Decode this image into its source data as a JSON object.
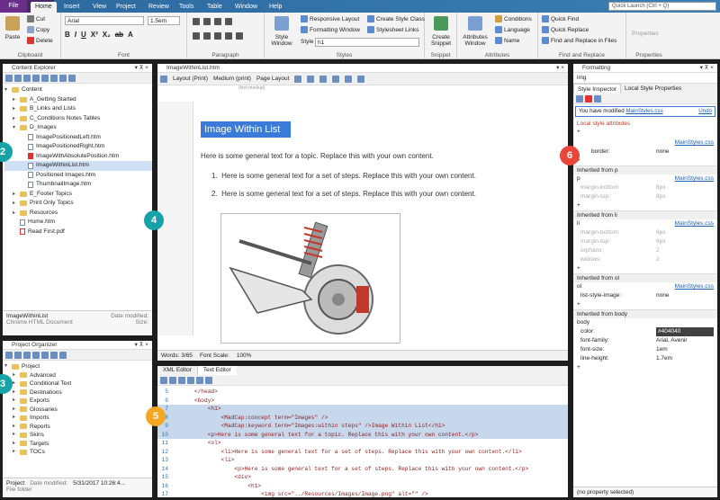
{
  "ribbon": {
    "file": "File",
    "tabs": [
      "Home",
      "Insert",
      "View",
      "Project",
      "Review",
      "Tools",
      "Table",
      "Window",
      "Help"
    ],
    "quick_launch": "Quick Launch (Ctrl + Q)",
    "clipboard": {
      "paste": "Paste",
      "cut": "Cut",
      "copy": "Copy",
      "delete": "Delete",
      "label": "Clipboard"
    },
    "font": {
      "family": "Arial",
      "size": "1.5em",
      "label": "Font"
    },
    "paragraph": {
      "label": "Paragraph"
    },
    "styles": {
      "style_window": "Style Window",
      "responsive": "Responsive Layout",
      "formatting": "Formatting Window",
      "create_class": "Create Style Class",
      "stylesheet_links": "Stylesheet Links",
      "style_label": "Style",
      "style_value": "h1",
      "label": "Styles"
    },
    "snippet": {
      "create": "Create Snippet",
      "label": "Snippet"
    },
    "attributes": {
      "window": "Attributes Window",
      "conditions": "Conditions",
      "language": "Language",
      "name": "Name",
      "label": "Attributes"
    },
    "find": {
      "quick_find": "Quick Find",
      "quick_replace": "Quick Replace",
      "find_replace": "Find and Replace in Files",
      "label": "Find and Replace"
    },
    "properties": {
      "props1": "Properties",
      "props2": "Properties"
    }
  },
  "content_explorer": {
    "title": "Content Explorer",
    "items": [
      {
        "t": "Content",
        "d": 0,
        "k": "folder"
      },
      {
        "t": "A_Getting Started",
        "d": 1,
        "k": "folder"
      },
      {
        "t": "B_Links and Lists",
        "d": 1,
        "k": "folder"
      },
      {
        "t": "C_Conditions Notes Tables",
        "d": 1,
        "k": "folder"
      },
      {
        "t": "D_Images",
        "d": 1,
        "k": "folder"
      },
      {
        "t": "ImagePositionedLeft.htm",
        "d": 2,
        "k": "file"
      },
      {
        "t": "ImagePositionedRight.htm",
        "d": 2,
        "k": "file"
      },
      {
        "t": "ImageWithAbsolutePosition.htm",
        "d": 2,
        "k": "file"
      },
      {
        "t": "ImageWithinList.htm",
        "d": 2,
        "k": "file"
      },
      {
        "t": "Positioned Images.htm",
        "d": 2,
        "k": "file"
      },
      {
        "t": "ThumbnailImage.htm",
        "d": 2,
        "k": "file"
      },
      {
        "t": "E_Footer Topics",
        "d": 1,
        "k": "folder"
      },
      {
        "t": "Print Only Topics",
        "d": 1,
        "k": "folder"
      },
      {
        "t": "Resources",
        "d": 1,
        "k": "folder"
      },
      {
        "t": "Home.htm",
        "d": 1,
        "k": "file"
      },
      {
        "t": "Read First.pdf",
        "d": 1,
        "k": "file"
      }
    ],
    "footer_name": "ImageWithinList",
    "footer_type": "Chrome HTML Document",
    "footer_modified": "Date modified:",
    "footer_size": "Size:"
  },
  "project_organizer": {
    "title": "Project Organizer",
    "items": [
      "Project",
      "Advanced",
      "Conditional Text",
      "Destinations",
      "Exports",
      "Glossaries",
      "Imports",
      "Reports",
      "Skins",
      "Targets",
      "TOCs"
    ],
    "footer_name": "Project",
    "footer_type": "File folder",
    "footer_modified": "Date modified:",
    "footer_date": "5/31/2017 10:26:4..."
  },
  "editor": {
    "tab": "ImageWithinList.htm",
    "layout": "Layout (Print)",
    "medium": "Medium (print)",
    "page_layout": "Page Layout",
    "markup": "(text markup)",
    "heading": "Image Within List",
    "para": "Here is some general text for a topic. Replace this with your own content.",
    "steps": [
      "Here is some general text for a set of steps. Replace this with your own content.",
      "Here is some general text for a set of steps. Replace this with your own content."
    ],
    "words": "Words: 3/65",
    "font_scale": "Font Scale:",
    "zoom": "100%"
  },
  "xml_editor": {
    "tab1": "XML Editor",
    "tab2": "Text Editor",
    "lines": [
      {
        "n": "5",
        "c": "    </head>"
      },
      {
        "n": "6",
        "c": "    <body>"
      },
      {
        "n": "7",
        "c": "        <h1>"
      },
      {
        "n": "8",
        "c": "            <MadCap:concept term=\"Images\" />"
      },
      {
        "n": "9",
        "c": "            <MadCap:keyword term=\"Images:within steps\" />Image Within List</h1>"
      },
      {
        "n": "10",
        "c": "        <p>Here is some general text for a topic. Replace this with your own content.</p>"
      },
      {
        "n": "11",
        "c": "        <ol>"
      },
      {
        "n": "12",
        "c": "            <li>Here is some general text for a set of steps. Replace this with your own content.</li>"
      },
      {
        "n": "13",
        "c": "            <li>"
      },
      {
        "n": "14",
        "c": "                <p>Here is some general text for a set of steps. Replace this with your own content.</p>"
      },
      {
        "n": "15",
        "c": "                <div>"
      },
      {
        "n": "16",
        "c": "                    <h1>"
      },
      {
        "n": "17",
        "c": "                        <img src=\"../Resources/Images/Image.png\" alt=\"\" />"
      }
    ]
  },
  "formatting": {
    "title": "Formatting",
    "element": "img",
    "tab1": "Style Inspector",
    "tab2": "Local Style Properties",
    "modified_prefix": "You have modified ",
    "modified_link": "MainStyles.css",
    "undo": "Undo",
    "local_attrs": "Local style attributes",
    "main_css": "MainStyles.css",
    "border_label": "border:",
    "border_val": "none",
    "sections": [
      {
        "title": "Inherited from p",
        "tag": "p",
        "link": "MainStyles.css",
        "props": [
          [
            "margin-bottom:",
            "8px"
          ],
          [
            "margin-top:",
            "8px"
          ]
        ]
      },
      {
        "title": "Inherited from li",
        "tag": "li",
        "link": "MainStyles.css",
        "props": [
          [
            "margin-bottom:",
            "6px"
          ],
          [
            "margin-top:",
            "6px"
          ],
          [
            "orphans:",
            "2"
          ],
          [
            "widows:",
            "2"
          ]
        ]
      },
      {
        "title": "Inherited from ol",
        "tag": "ol",
        "link": "MainStyles.css",
        "props": [
          [
            "list-style-image:",
            "none"
          ]
        ]
      },
      {
        "title": "Inherited from body",
        "tag": "body",
        "link": "",
        "props": [
          [
            "color:",
            "#404040"
          ],
          [
            "font-family:",
            "Arial, Avenir"
          ],
          [
            "font-size:",
            "1em"
          ],
          [
            "line-height:",
            "1.7em"
          ]
        ]
      }
    ],
    "footer": "(no property selected)"
  },
  "badges": [
    "2",
    "3",
    "4",
    "5",
    "6"
  ],
  "colors": {
    "teal": "#17a2a8",
    "orange": "#f5a623",
    "red": "#e8463a",
    "highlight": "#3a7ad8"
  }
}
